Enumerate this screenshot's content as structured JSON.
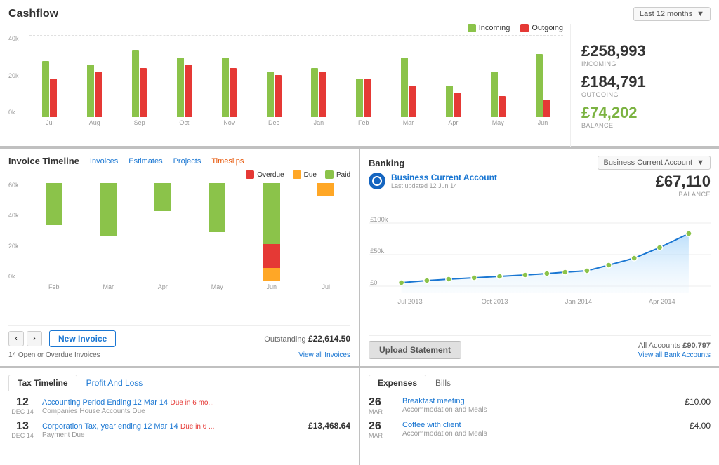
{
  "cashflow": {
    "title": "Cashflow",
    "period": "Last 12 months",
    "legend": {
      "incoming": "Incoming",
      "outgoing": "Outgoing"
    },
    "stats": {
      "incoming": "£258,993",
      "incoming_label": "INCOMING",
      "outgoing": "£184,791",
      "outgoing_label": "OUTGOING",
      "balance": "£74,202",
      "balance_label": "BALANCE"
    },
    "bars": [
      {
        "label": "Jul",
        "green": 80,
        "red": 55
      },
      {
        "label": "Aug",
        "green": 75,
        "red": 65
      },
      {
        "label": "Sep",
        "green": 95,
        "red": 70
      },
      {
        "label": "Oct",
        "green": 85,
        "red": 75
      },
      {
        "label": "Nov",
        "green": 85,
        "red": 70
      },
      {
        "label": "Dec",
        "green": 65,
        "red": 60
      },
      {
        "label": "Jan",
        "green": 70,
        "red": 65
      },
      {
        "label": "Feb",
        "green": 55,
        "red": 55
      },
      {
        "label": "Mar",
        "green": 85,
        "red": 45
      },
      {
        "label": "Apr",
        "green": 45,
        "red": 35
      },
      {
        "label": "May",
        "green": 65,
        "red": 30
      },
      {
        "label": "Jun",
        "green": 90,
        "red": 25
      }
    ],
    "yaxis": [
      "40k",
      "20k",
      "0k"
    ]
  },
  "invoice": {
    "title": "Invoice Timeline",
    "tabs": [
      "Invoices",
      "Estimates",
      "Projects",
      "Timeslips"
    ],
    "legend": {
      "overdue": "Overdue",
      "due": "Due",
      "paid": "Paid"
    },
    "bars": [
      {
        "label": "Feb",
        "paid": 60,
        "due": 0,
        "overdue": 0
      },
      {
        "label": "Mar",
        "paid": 75,
        "due": 0,
        "overdue": 0
      },
      {
        "label": "Apr",
        "paid": 40,
        "due": 0,
        "overdue": 0
      },
      {
        "label": "May",
        "paid": 70,
        "due": 0,
        "overdue": 0
      },
      {
        "label": "Jun",
        "paid": 90,
        "due": 20,
        "overdue": 35
      },
      {
        "label": "Jul",
        "paid": 0,
        "due": 18,
        "overdue": 0
      }
    ],
    "yaxis": [
      "60k",
      "40k",
      "20k",
      "0k"
    ],
    "outstanding_label": "Outstanding",
    "outstanding_amount": "£22,614.50",
    "new_invoice": "New Invoice",
    "open_count": "14 Open or Overdue Invoices",
    "view_all": "View all Invoices"
  },
  "banking": {
    "title": "Banking",
    "period": "Business Current Account",
    "account_name": "Business Current Account",
    "last_updated": "Last updated 12 Jun 14",
    "balance": "£67,110",
    "balance_label": "BALANCE",
    "upload_btn": "Upload Statement",
    "all_accounts_label": "All Accounts",
    "all_accounts_amount": "£90,797",
    "view_all": "View all Bank Accounts",
    "chart_labels": [
      "Jul 2013",
      "Oct 2013",
      "Jan 2014",
      "Apr 2014"
    ]
  },
  "tax": {
    "tabs": [
      "Tax Timeline",
      "Profit And Loss"
    ],
    "entries": [
      {
        "day": "12",
        "month": "DEC 14",
        "title": "Accounting Period Ending 12 Mar 14",
        "due": "Due in 6 mo...",
        "sub": "Companies House Accounts Due",
        "amount": ""
      },
      {
        "day": "13",
        "month": "DEC 14",
        "title": "Corporation Tax, year ending 12 Mar 14",
        "due": "Due in 6 ...",
        "sub": "Payment Due",
        "amount": "£13,468.64"
      }
    ]
  },
  "expenses": {
    "tabs": [
      "Expenses",
      "Bills"
    ],
    "entries": [
      {
        "day": "26",
        "month": "MAR",
        "title": "Breakfast meeting",
        "sub": "Accommodation and Meals",
        "amount": "£10.00"
      },
      {
        "day": "26",
        "month": "MAR",
        "title": "Coffee with client",
        "sub": "Accommodation and Meals",
        "amount": "£4.00"
      }
    ]
  }
}
